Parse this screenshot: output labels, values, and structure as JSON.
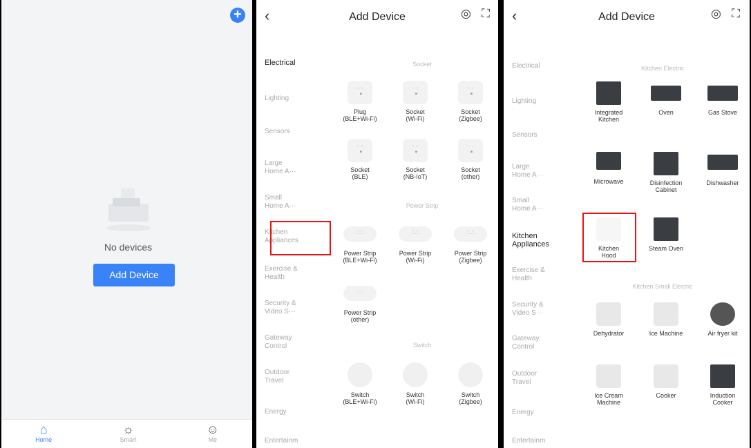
{
  "screen1": {
    "no_devices": "No devices",
    "add_device_btn": "Add Device",
    "tabs": [
      "Home",
      "Smart",
      "Me"
    ]
  },
  "screen2": {
    "title": "Add Device",
    "sidebar": [
      "Electrical",
      "Lighting",
      "Sensors",
      "Large Home A···",
      "Small Home A···",
      "Kitchen Appliances",
      "Exercise & Health",
      "Security & Video S···",
      "Gateway Control",
      "Outdoor Travel",
      "Energy",
      "Entertainm"
    ],
    "sections": [
      "Socket",
      "Power Strip",
      "Switch"
    ],
    "devices": [
      [
        "Plug",
        "(BLE+Wi-Fi)"
      ],
      [
        "Socket",
        "(Wi-Fi)"
      ],
      [
        "Socket",
        "(Zigbee)"
      ],
      [
        "Socket",
        "(BLE)"
      ],
      [
        "Socket",
        "(NB-IoT)"
      ],
      [
        "Socket",
        "(other)"
      ],
      [
        "Power Strip",
        "(BLE+Wi-Fi)"
      ],
      [
        "Power Strip",
        "(Wi-Fi)"
      ],
      [
        "Power Strip",
        "(Zigbee)"
      ],
      [
        "Power Strip",
        "(other)"
      ],
      [
        "Switch",
        "(BLE+Wi-Fi)"
      ],
      [
        "Switch",
        "(Wi-Fi)"
      ],
      [
        "Switch",
        "(Zigbee)"
      ]
    ]
  },
  "screen3": {
    "title": "Add Device",
    "sidebar": [
      "Electrical",
      "Lighting",
      "Sensors",
      "Large Home A···",
      "Small Home A···",
      "Kitchen Appliances",
      "Exercise & Health",
      "Security & Video S···",
      "Gateway Control",
      "Outdoor Travel",
      "Energy",
      "Entertainm"
    ],
    "sections": [
      "Kitchen Electric",
      "Kitchen Small Electric"
    ],
    "devices": [
      [
        "Integrated",
        "Kitchen"
      ],
      [
        "Oven",
        ""
      ],
      [
        "Gas Stove",
        ""
      ],
      [
        "Microwave",
        ""
      ],
      [
        "Disinfection",
        "Cabinet"
      ],
      [
        "Dishwasher",
        ""
      ],
      [
        "Kitchen",
        "Hood"
      ],
      [
        "Steam Oven",
        ""
      ],
      [
        "Dehydrator",
        ""
      ],
      [
        "Ice Machine",
        ""
      ],
      [
        "Air fryer kit",
        ""
      ],
      [
        "Ice Cream",
        "Machine"
      ],
      [
        "Cooker",
        ""
      ],
      [
        "Induction",
        "Cooker"
      ]
    ]
  }
}
